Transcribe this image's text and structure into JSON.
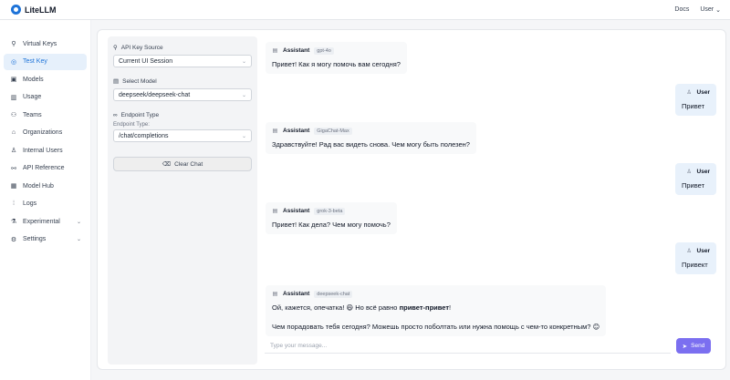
{
  "app": {
    "title": "LiteLLM"
  },
  "topbar": {
    "docs_label": "Docs",
    "user_label": "User"
  },
  "sidebar": {
    "items": [
      {
        "label": "Virtual Keys",
        "icon": "key-icon"
      },
      {
        "label": "Test Key",
        "icon": "play-circle-icon"
      },
      {
        "label": "Models",
        "icon": "block-icon"
      },
      {
        "label": "Usage",
        "icon": "bar-chart-icon"
      },
      {
        "label": "Teams",
        "icon": "team-icon"
      },
      {
        "label": "Organizations",
        "icon": "bank-icon"
      },
      {
        "label": "Internal Users",
        "icon": "user-icon"
      },
      {
        "label": "API Reference",
        "icon": "api-icon"
      },
      {
        "label": "Model Hub",
        "icon": "app-store-icon"
      },
      {
        "label": "Logs",
        "icon": "line-chart-icon"
      },
      {
        "label": "Experimental",
        "icon": "experiment-icon"
      },
      {
        "label": "Settings",
        "icon": "gear-icon"
      }
    ]
  },
  "config": {
    "api_key_source_label": "API Key Source",
    "api_key_source_value": "Current UI Session",
    "select_model_label": "Select Model",
    "select_model_value": "deepseek/deepseek-chat",
    "endpoint_type_label": "Endpoint Type",
    "endpoint_type_sublabel": "Endpoint Type:",
    "endpoint_type_value": "/chat/completions",
    "clear_chat_label": "Clear Chat"
  },
  "chat": {
    "assistant_role": "Assistant",
    "user_role": "User",
    "messages": [
      {
        "role": "assistant",
        "model": "gpt-4o",
        "text": "Привет! Как я могу помочь вам сегодня?"
      },
      {
        "role": "user",
        "text": "Привет"
      },
      {
        "role": "assistant",
        "model": "GigaChat-Max",
        "text": "Здравствуйте! Рад вас видеть снова. Чем могу быть полезен?"
      },
      {
        "role": "user",
        "text": "Привет"
      },
      {
        "role": "assistant",
        "model": "grok-3-beta",
        "text": "Привет! Как дела? Чем могу помочь?"
      },
      {
        "role": "user",
        "text": "Привект"
      },
      {
        "role": "assistant",
        "model": "deepseek-chat",
        "line1_start": "Ой, кажется, опечатка! 😄 Но всё равно ",
        "line1_bold": "привет-привет",
        "line1_end": "!",
        "line2": "Чем порадовать тебя сегодня? Можешь просто поболтать или нужна помощь с чем-то конкретным? 😊"
      }
    ]
  },
  "composer": {
    "placeholder": "Type your message...",
    "send_label": "Send"
  },
  "colors": {
    "accent": "#1e73d8",
    "send": "#7b6ff0",
    "active_bg": "#e6f0fb"
  }
}
